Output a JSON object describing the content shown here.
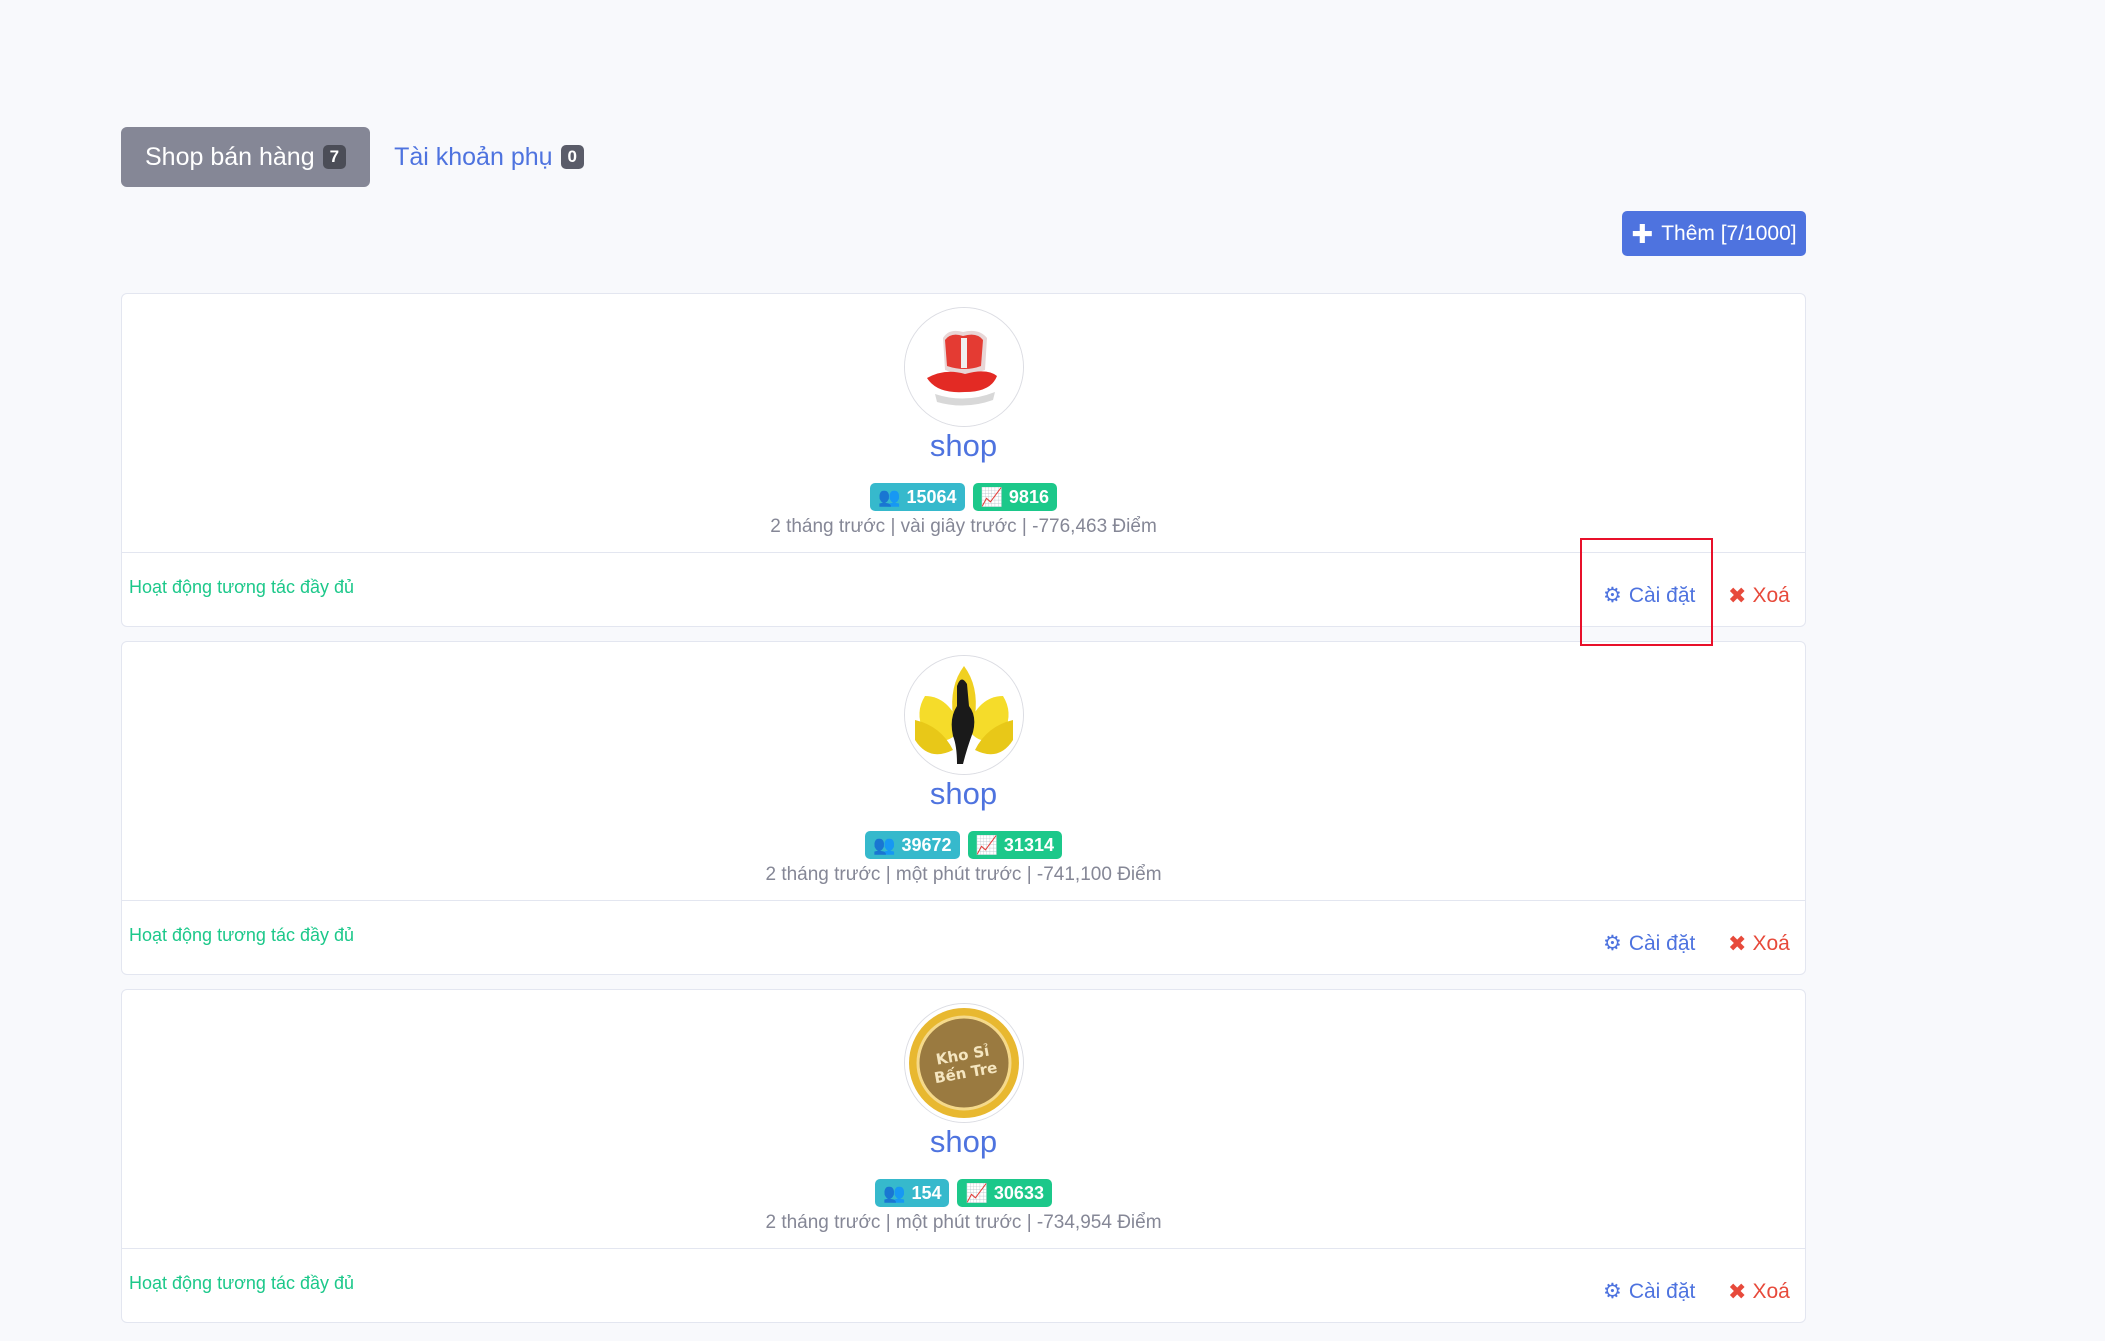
{
  "tabs": [
    {
      "label": "Shop bán hàng",
      "count": "7",
      "active": true
    },
    {
      "label": "Tài khoản phụ",
      "count": "0",
      "active": false
    }
  ],
  "add_button": {
    "label": "Thêm [7/1000]",
    "icon": "plus-icon"
  },
  "shops": [
    {
      "name": "shop",
      "avatar": "red-chair-logo",
      "followers": "15064",
      "growth": "9816",
      "meta": "2 tháng trước | vài giây trước | -776,463 Điểm",
      "activity": "Hoạt động tương tác đầy đủ",
      "settings_label": "Cài đặt",
      "delete_label": "Xoá"
    },
    {
      "name": "shop",
      "avatar": "yellow-lotus-logo",
      "followers": "39672",
      "growth": "31314",
      "meta": "2 tháng trước | một phút trước | -741,100 Điểm",
      "activity": "Hoạt động tương tác đầy đủ",
      "settings_label": "Cài đặt",
      "delete_label": "Xoá"
    },
    {
      "name": "shop",
      "avatar": "gold-seal-logo",
      "avatar_text": [
        "Kho Sỉ",
        "Bến Tre"
      ],
      "followers": "154",
      "growth": "30633",
      "meta": "2 tháng trước | một phút trước | -734,954 Điểm",
      "activity": "Hoạt động tương tác đầy đủ",
      "settings_label": "Cài đặt",
      "delete_label": "Xoá"
    }
  ],
  "colors": {
    "primary": "#4e73df",
    "info": "#36b9cc",
    "success": "#1cc88a",
    "danger": "#e74a3b",
    "secondary": "#858796",
    "highlight": "#e8102a"
  }
}
